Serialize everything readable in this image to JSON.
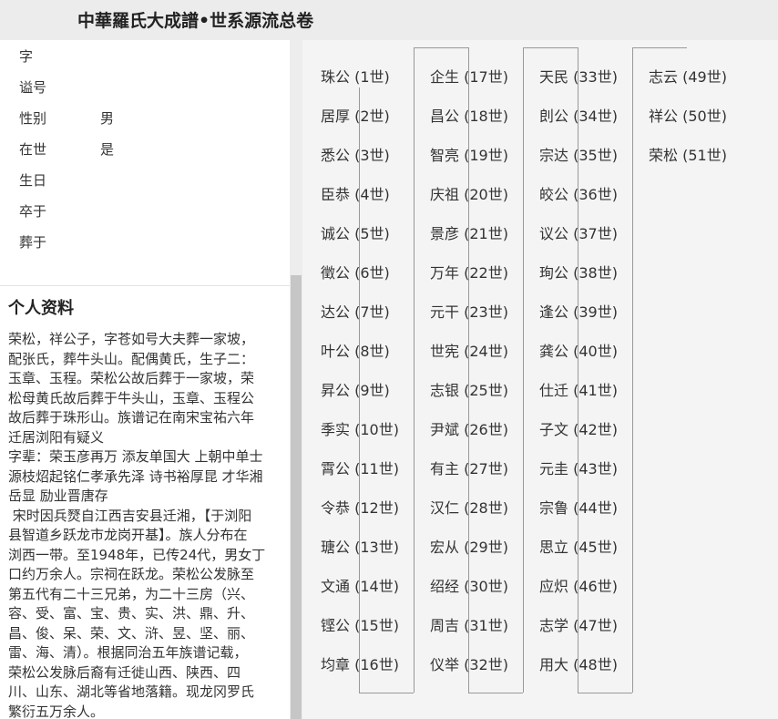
{
  "header": {
    "title": "中華羅氏大成譜•世系源流总卷"
  },
  "profile": {
    "fields": [
      {
        "label": "字",
        "value": ""
      },
      {
        "label": "谥号",
        "value": ""
      },
      {
        "label": "性别",
        "value": "男"
      },
      {
        "label": "在世",
        "value": "是"
      },
      {
        "label": "生日",
        "value": ""
      },
      {
        "label": "卒于",
        "value": ""
      },
      {
        "label": "葬于",
        "value": ""
      }
    ]
  },
  "personal": {
    "title": "个人资料",
    "lines": [
      "荣松，祥公子，字苍如号大夫葬一家坡，",
      "配张氏，葬牛头山。配偶黄氏，生子二：",
      "玉章、玉程。荣松公故后葬于一家坡，荣",
      "松母黄氏故后葬于牛头山，玉章、玉程公",
      "故后葬于珠形山。族谱记在南宋宝祐六年",
      "迁居浏阳有疑义",
      "字辈：荣玉彦再万 添友单国大 上朝中单士",
      "源枝炤起铭仁孝承先泽 诗书裕厚昆 才华湘",
      "岳显 励业晋唐存",
      " 宋时因兵燹自江西吉安县迁湘，【于浏阳",
      "县智道乡跃龙市龙岗开基】。族人分布在",
      "浏西一带。至1948年，已传24代，男女丁",
      "口约万余人。宗祠在跃龙。荣松公发脉至",
      "第五代有二十三兄弟，为二十三房（兴、",
      "容、受、富、宝、贵、实、洪、鼎、升、",
      "昌、俊、呆、荣、文、浒、昱、坚、丽、",
      "雷、海、清）。根据同治五年族谱记载，",
      "荣松公发脉后裔有迁徙山西、陕西、四",
      "川、山东、湖北等省地落籍。现龙冈罗氏",
      "繁衍五万余人。"
    ]
  },
  "lineage": {
    "columns": [
      [
        {
          "name": "珠公",
          "gen": "(1世)"
        },
        {
          "name": "居厚",
          "gen": "(2世)"
        },
        {
          "name": "悉公",
          "gen": "(3世)"
        },
        {
          "name": "臣恭",
          "gen": "(4世)"
        },
        {
          "name": "诚公",
          "gen": "(5世)"
        },
        {
          "name": "徵公",
          "gen": "(6世)"
        },
        {
          "name": "达公",
          "gen": "(7世)"
        },
        {
          "name": "叶公",
          "gen": "(8世)"
        },
        {
          "name": "昇公",
          "gen": "(9世)"
        },
        {
          "name": "季实",
          "gen": "(10世)"
        },
        {
          "name": "霄公",
          "gen": "(11世)"
        },
        {
          "name": "令恭",
          "gen": "(12世)"
        },
        {
          "name": "瑭公",
          "gen": "(13世)"
        },
        {
          "name": "文通",
          "gen": "(14世)"
        },
        {
          "name": "铿公",
          "gen": "(15世)"
        },
        {
          "name": "均章",
          "gen": "(16世)"
        }
      ],
      [
        {
          "name": "企生",
          "gen": "(17世)"
        },
        {
          "name": "昌公",
          "gen": "(18世)"
        },
        {
          "name": "智亮",
          "gen": "(19世)"
        },
        {
          "name": "庆祖",
          "gen": "(20世)"
        },
        {
          "name": "景彦",
          "gen": "(21世)"
        },
        {
          "name": "万年",
          "gen": "(22世)"
        },
        {
          "name": "元干",
          "gen": "(23世)"
        },
        {
          "name": "世宪",
          "gen": "(24世)"
        },
        {
          "name": "志银",
          "gen": "(25世)"
        },
        {
          "name": "尹斌",
          "gen": "(26世)"
        },
        {
          "name": "有主",
          "gen": "(27世)"
        },
        {
          "name": "汉仁",
          "gen": "(28世)"
        },
        {
          "name": "宏从",
          "gen": "(29世)"
        },
        {
          "name": "绍经",
          "gen": "(30世)"
        },
        {
          "name": "周吉",
          "gen": "(31世)"
        },
        {
          "name": "仪举",
          "gen": "(32世)"
        }
      ],
      [
        {
          "name": "天民",
          "gen": "(33世)"
        },
        {
          "name": "剆公",
          "gen": "(34世)"
        },
        {
          "name": "宗达",
          "gen": "(35世)"
        },
        {
          "name": "皎公",
          "gen": "(36世)"
        },
        {
          "name": "议公",
          "gen": "(37世)"
        },
        {
          "name": "珣公",
          "gen": "(38世)"
        },
        {
          "name": "逢公",
          "gen": "(39世)"
        },
        {
          "name": "龚公",
          "gen": "(40世)"
        },
        {
          "name": "仕迁",
          "gen": "(41世)"
        },
        {
          "name": "子文",
          "gen": "(42世)"
        },
        {
          "name": "元圭",
          "gen": "(43世)"
        },
        {
          "name": "宗鲁",
          "gen": "(44世)"
        },
        {
          "name": "思立",
          "gen": "(45世)"
        },
        {
          "name": "应炽",
          "gen": "(46世)"
        },
        {
          "name": "志学",
          "gen": "(47世)"
        },
        {
          "name": "用大",
          "gen": "(48世)"
        }
      ],
      [
        {
          "name": "志云",
          "gen": "(49世)"
        },
        {
          "name": "祥公",
          "gen": "(50世)"
        },
        {
          "name": "荣松",
          "gen": "(51世)"
        }
      ]
    ]
  }
}
